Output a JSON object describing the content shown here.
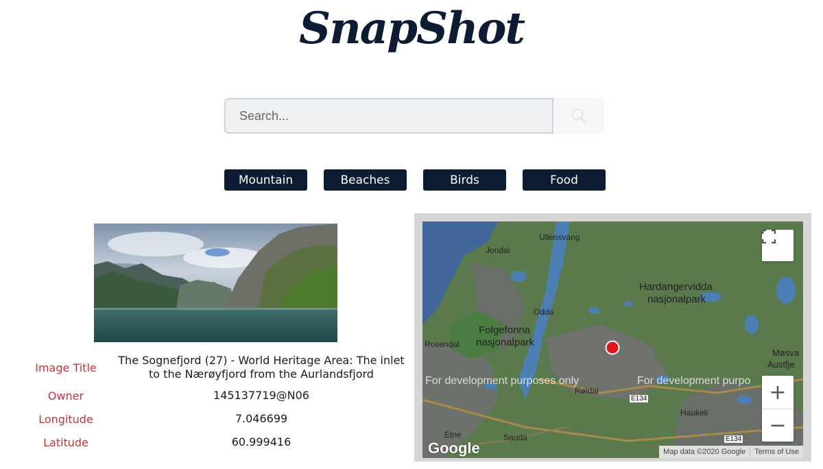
{
  "header": {
    "logo_text": "SnapShot"
  },
  "search": {
    "placeholder": "Search...",
    "value": "",
    "button_icon": "search-icon"
  },
  "categories": [
    "Mountain",
    "Beaches",
    "Birds",
    "Food"
  ],
  "photo_info": {
    "title_label": "Image Title",
    "title_value": "The Sognefjord (27) - World Heritage Area: The inlet to the Nærøyfjord from the Aurlandsfjord",
    "owner_label": "Owner",
    "owner_value": "145137719@N06",
    "longitude_label": "Longitude",
    "longitude_value": "7.046699",
    "latitude_label": "Latitude",
    "latitude_value": "60.999416"
  },
  "map": {
    "places": {
      "ullensvang": "Ullensvang",
      "jondal": "Jondal",
      "hardangervidda": "Hardangervidda",
      "hardangervidda2": "nasjonalpark",
      "odda": "Odda",
      "folgefonna": "Folgefonna",
      "folgefonna2": "nasjonalpark",
      "rosendal": "Rosendal",
      "roldal": "Røldal",
      "haukeli": "Haukeli",
      "etne": "Etne",
      "sauda": "Sauda",
      "mosvatn": "Møsva",
      "austfjell": "Austfje",
      "e134a": "E134",
      "e134b": "E134"
    },
    "dev_text": "For development purposes only",
    "dev_text_cut": "For development purpo",
    "google_logo": "Google",
    "attribution": "Map data ©2020 Google",
    "terms": "Terms of Use",
    "marker_color": "#e0161b",
    "fullscreen_icon": "fullscreen-icon",
    "zoom_in_label": "+",
    "zoom_out_label": "−"
  },
  "colors": {
    "brand": "#0d1b33",
    "label_red": "#c8323a",
    "map_green": "#5e8f4f",
    "map_water": "#4a7fb5"
  }
}
